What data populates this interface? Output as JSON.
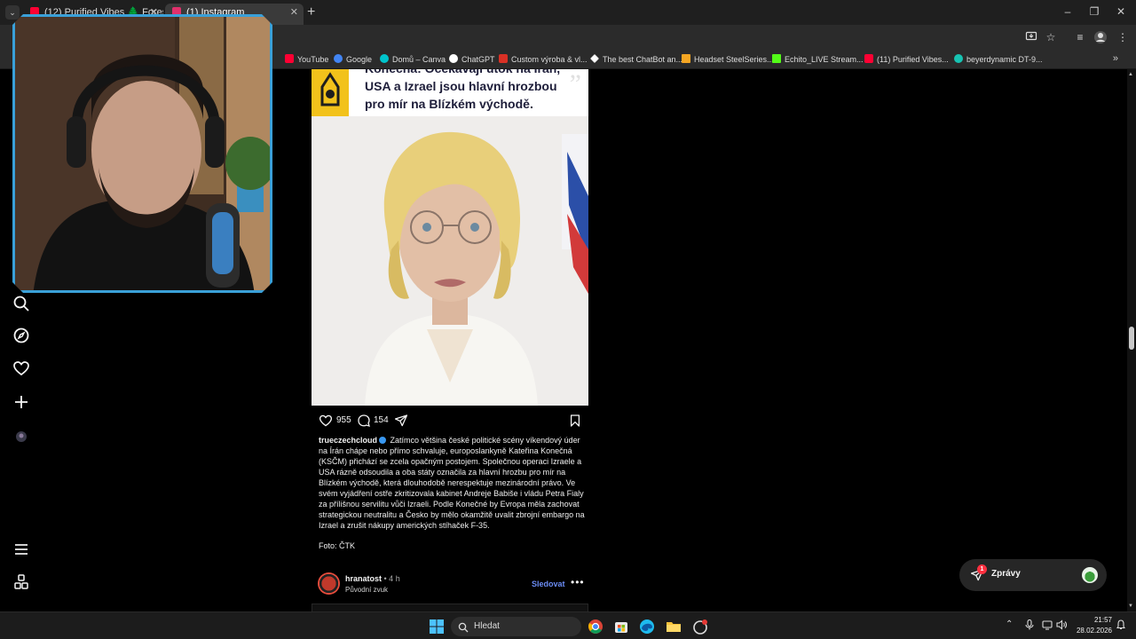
{
  "browser": {
    "tabs": [
      {
        "title": "(12) Purified Vibes 🌲 Forest ...",
        "favicon_color": "#ff0033",
        "active": false
      },
      {
        "title": "(1) Instagram",
        "favicon_color": "#e1306c",
        "active": true
      }
    ],
    "new_tab_label": "+",
    "bookmarks": [
      {
        "label": "YouTube",
        "color": "#ff0033"
      },
      {
        "label": "Google",
        "color": "#4285f4"
      },
      {
        "label": "Domů – Canva",
        "color": "#00c4cc"
      },
      {
        "label": "ChatGPT",
        "color": "#ffffff"
      },
      {
        "label": "Custom výroba & vl...",
        "color": "#d93025"
      },
      {
        "label": "The best ChatBot an...",
        "color": "#ffffff"
      },
      {
        "label": "Headset SteelSeries...",
        "color": "#f5a623"
      },
      {
        "label": "Echito_LIVE Stream...",
        "color": "#53fc18"
      },
      {
        "label": "(11) Purified Vibes...",
        "color": "#ff0033"
      },
      {
        "label": "beyerdynamic DT-9...",
        "color": "#17c3b2"
      }
    ]
  },
  "post": {
    "headline_cut": "Konečná: Očekávají útok na Írán,",
    "headline_lines": [
      "USA a Izrael jsou hlavní hrozbou",
      "pro mír na Blízkém východě."
    ],
    "likes": "955",
    "comments": "154",
    "username": "trueczechcloud",
    "caption": "Zatímco většina české politické scény víkendový úder na Írán chápe nebo přímo schvaluje, europoslankyně Kateřina Konečná (KSČM) přichází se zcela opačným postojem. Společnou operaci Izraele a USA rázně odsoudila a oba státy označila za hlavní hrozbu pro mír na Blízkém východě, která dlouhodobě nerespektuje mezinárodní právo. Ve svém vyjádření ostře zkritizovala kabinet Andreje Babiše i vládu Petra Fialy za přílišnou servilitu vůči Izraeli. Podle Konečné by Evropa měla zachovat strategickou neutralitu a Česko by mělo okamžitě uvalit zbrojní embargo na Izrael a zrušit nákupy amerických stíhaček F-35.",
    "photo_credit": "Foto: ČTK"
  },
  "next_post": {
    "username": "hranatost",
    "time": "• 4 h",
    "subtitle": "Původní zvuk",
    "follow_label": "Sledovat",
    "more_label": "•••"
  },
  "messages": {
    "label": "Zprávy",
    "badge": "1"
  },
  "taskbar": {
    "search_placeholder": "Hledat",
    "time": "21:57",
    "date": "28.02.2026"
  }
}
